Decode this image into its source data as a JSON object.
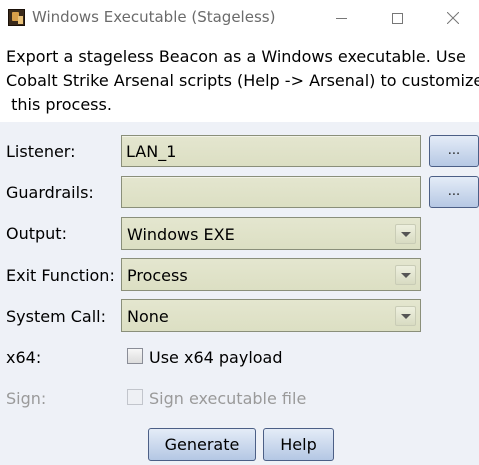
{
  "window": {
    "title": "Windows Executable (Stageless)"
  },
  "description": {
    "line1": "Export a stageless Beacon as a Windows executable. Use",
    "line2": "Cobalt Strike Arsenal scripts (Help -> Arsenal) to customize",
    "line3": " this process."
  },
  "form": {
    "listener": {
      "label": "Listener:",
      "value": "LAN_1",
      "button_label": "..."
    },
    "guardrails": {
      "label": "Guardrails:",
      "value": "",
      "button_label": "..."
    },
    "output": {
      "label": "Output:",
      "value": "Windows EXE"
    },
    "exit_function": {
      "label": "Exit Function:",
      "value": "Process"
    },
    "system_call": {
      "label": "System Call:",
      "value": "None"
    },
    "x64": {
      "label": "x64:",
      "checkbox_label": "Use x64 payload",
      "checked": false
    },
    "sign": {
      "label": "Sign:",
      "checkbox_label": "Sign executable file",
      "checked": false,
      "enabled": false
    }
  },
  "buttons": {
    "generate": "Generate",
    "help": "Help"
  }
}
